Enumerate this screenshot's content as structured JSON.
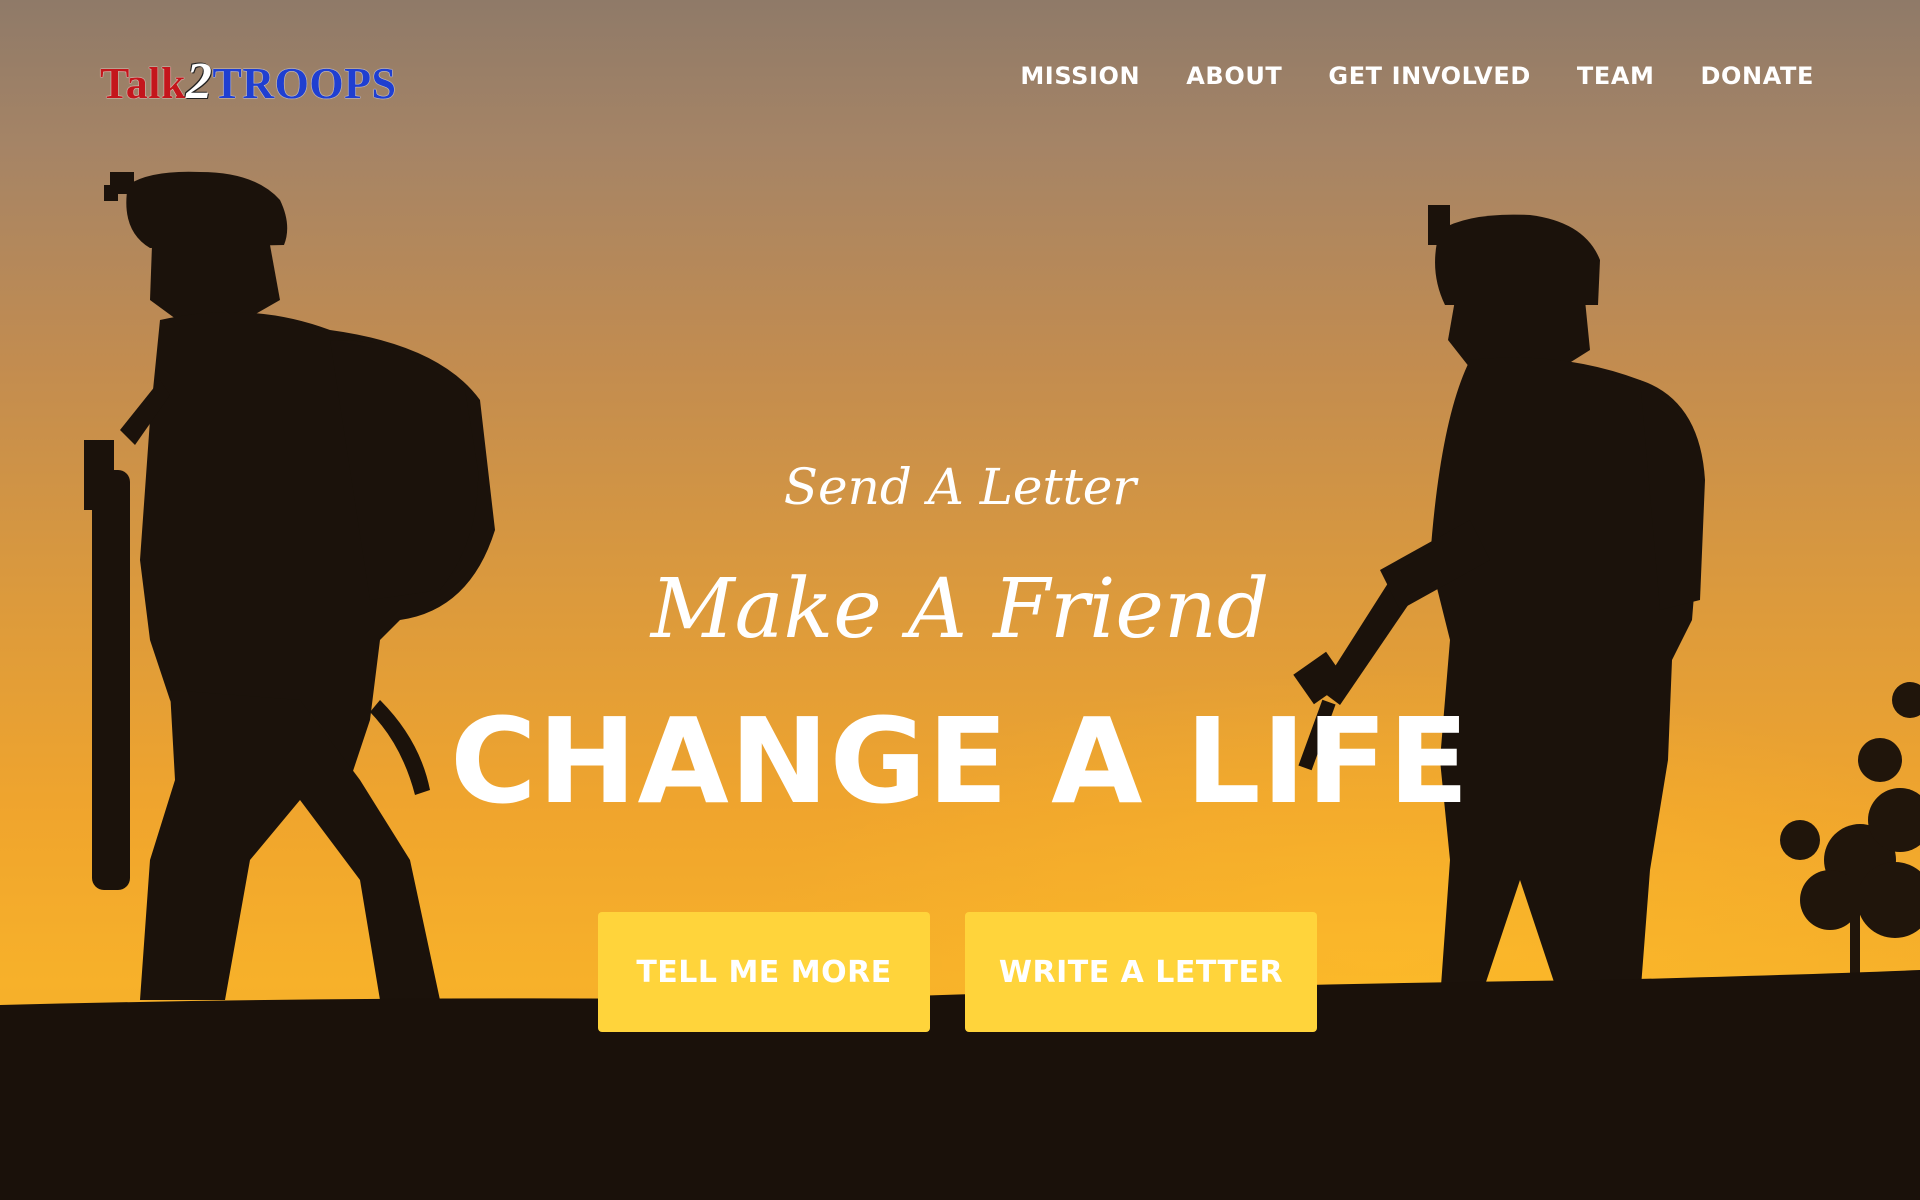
{
  "logo": {
    "part1": "Talk",
    "part2": "2",
    "part3": "TROOPS"
  },
  "nav": {
    "items": [
      {
        "label": "MISSION"
      },
      {
        "label": "ABOUT"
      },
      {
        "label": "GET INVOLVED"
      },
      {
        "label": "TEAM"
      },
      {
        "label": "DONATE"
      }
    ]
  },
  "hero": {
    "line1": "Send A Letter",
    "line2": "Make A Friend",
    "line3": "CHANGE A LIFE",
    "buttons": {
      "tell_more": "TELL ME MORE",
      "write_letter": "WRITE A LETTER"
    }
  },
  "colors": {
    "accent": "#ffd43b",
    "logo_red": "#c4161c",
    "logo_blue": "#1f3fd1"
  }
}
